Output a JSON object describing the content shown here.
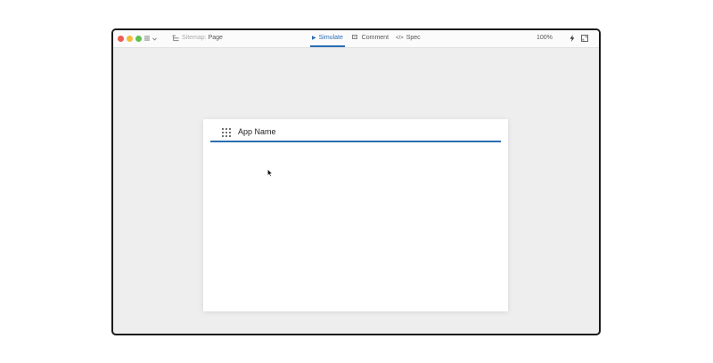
{
  "toolbar": {
    "breadcrumb": {
      "parent": "Sitemap",
      "current": "Page"
    },
    "tabs": [
      {
        "label": "Simulate",
        "icon": "play-icon",
        "active": true
      },
      {
        "label": "Comment",
        "icon": "comment-icon",
        "active": false
      },
      {
        "label": "Spec",
        "icon": "code-icon",
        "active": false
      }
    ],
    "zoom": "100%",
    "icons": {
      "menu": "hamburger-icon",
      "dropdown": "chevron-down-icon",
      "sitemap": "sitemap-icon",
      "lightning": "lightning-icon",
      "fullscreen": "fullscreen-icon"
    }
  },
  "canvas": {
    "app_name": "App Name",
    "app_icon": "apps-grid-icon"
  },
  "colors": {
    "accent": "#2a6db3",
    "close": "#ee5b50",
    "minimize": "#f4bd3a",
    "maximize": "#5fc24e",
    "canvas_bg": "#efeeef"
  }
}
